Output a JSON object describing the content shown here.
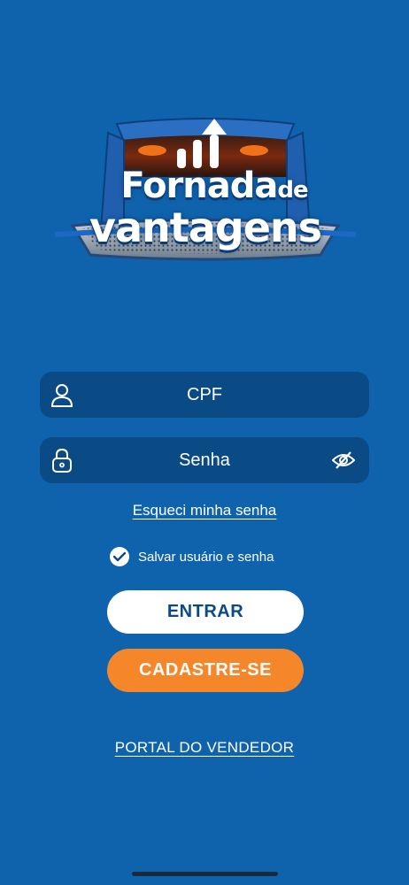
{
  "logo": {
    "line1": "Fornada",
    "line1_small": "de",
    "line2": "vantagens"
  },
  "form": {
    "cpf_placeholder": "CPF",
    "password_placeholder": "Senha",
    "forgot_password": "Esqueci minha senha",
    "remember_label": "Salvar usuário e senha",
    "remember_checked": true
  },
  "buttons": {
    "login": "ENTRAR",
    "signup": "CADASTRE-SE"
  },
  "footer": {
    "vendor_portal": "PORTAL DO VENDEDOR"
  },
  "colors": {
    "background": "#0f63ad",
    "field": "#0a4a85",
    "accent_orange": "#f5862a",
    "primary_text": "#0b4a86"
  }
}
